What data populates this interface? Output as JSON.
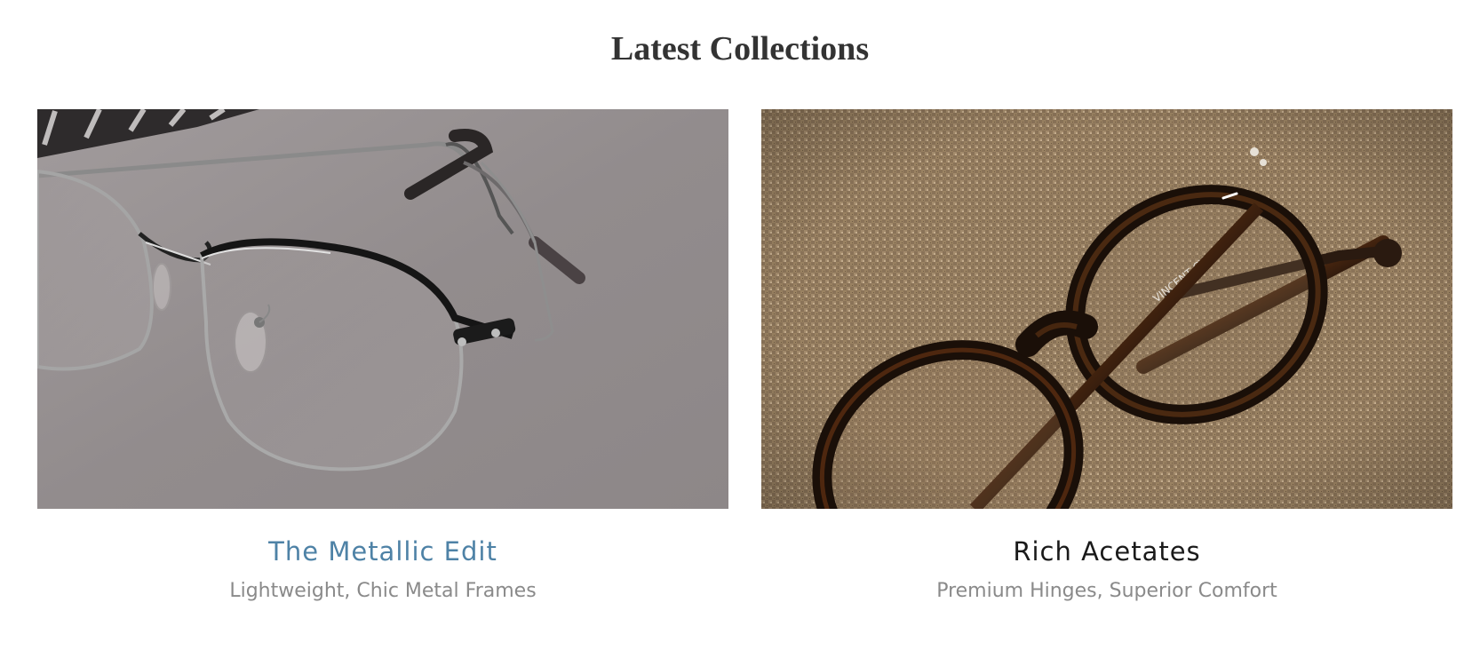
{
  "section": {
    "title": "Latest Collections"
  },
  "collections": [
    {
      "title": "The Metallic Edit",
      "subtitle": "Lightweight, Chic Metal Frames",
      "title_color": "#4e82a6",
      "image_icon": "metal-frame-glasses-photo"
    },
    {
      "title": "Rich Acetates",
      "subtitle": "Premium Hinges, Superior Comfort",
      "title_color": "#1a1a1a",
      "image_icon": "acetate-round-glasses-photo"
    }
  ],
  "brand_engraving": "VINCENT CHASE"
}
